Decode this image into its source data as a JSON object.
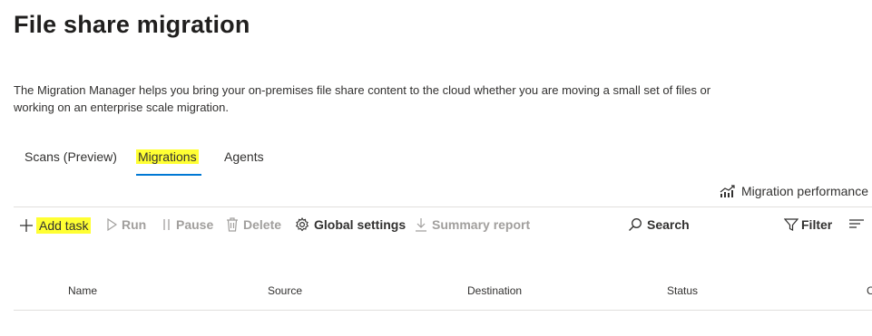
{
  "page": {
    "title": "File share migration",
    "description": "The Migration Manager helps you bring your on-premises file share content to the cloud whether you are moving a small set of files or working on an enterprise scale migration."
  },
  "tabs": [
    {
      "label": "Scans (Preview)"
    },
    {
      "label": "Migrations",
      "selected": true
    },
    {
      "label": "Agents"
    }
  ],
  "performance_link": "Migration performance",
  "toolbar": {
    "add_task": "Add task",
    "run": "Run",
    "pause": "Pause",
    "delete": "Delete",
    "global_settings": "Global settings",
    "summary_report": "Summary report",
    "search": "Search",
    "filter": "Filter"
  },
  "columns": [
    "Name",
    "Source",
    "Destination",
    "Status",
    "C"
  ],
  "colors": {
    "highlight": "#ffff33",
    "accent": "#0078d4",
    "disabled_text": "#a19f9d",
    "divider": "#e1dfdd"
  },
  "icons": [
    "chart-icon",
    "plus-icon",
    "play-icon",
    "pause-icon",
    "trash-icon",
    "gear-icon",
    "download-icon",
    "search-icon",
    "filter-icon",
    "menu-lines-icon"
  ]
}
